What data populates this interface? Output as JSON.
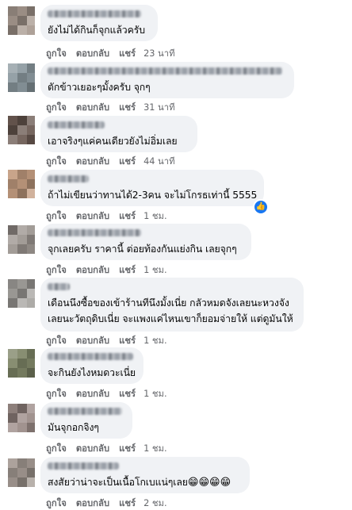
{
  "actions": {
    "like": "ถูกใจ",
    "reply": "ตอบกลับ",
    "share": "แชร์"
  },
  "comments": [
    {
      "text": [
        "ยังไม่ได้กินก็จุกแล้วครับ"
      ],
      "time": "23 นาที"
    },
    {
      "text": [
        "ตักข้าวเยอะๆมั้งครับ จุกๆ"
      ],
      "time": "31 นาที"
    },
    {
      "text": [
        "เอาจริงๆแค่คนเดียวยังไม่อิ่มเลย"
      ],
      "time": "44 นาที"
    },
    {
      "text": [
        "ถ้าไม่เขียนว่าทานได้2-3คน จะไม่โกรธเท่านี้ 5555"
      ],
      "time": "1 ชม.",
      "reaction_icon": "like-icon",
      "reaction_glyph": "👍"
    },
    {
      "text": [
        "จุกเลยครับ ราคานี้ ต่อยท้องกันแย่งกิน เลยจุกๆ"
      ],
      "time": "1 ชม."
    },
    {
      "text": [
        "เดือนนึงซื้อของเข้าร้านทีนึงมั้งเนี่ย กลัวหมดจังเลยนะหวงจัง",
        "เลยนะวัตถุดิบเนี่ย จะแพงแค่ไหนเขาก็ยอมจ่ายให้ แต่ดูมันให้"
      ],
      "time": "1 ชม."
    },
    {
      "text": [
        "จะกินยังไงหมดวะเนี่ย"
      ],
      "time": "1 ชม."
    },
    {
      "text": [
        "มันจุกอกจิงๆ"
      ],
      "time": "1 ชม."
    },
    {
      "text": [
        "สงสัยว่าน่าจะเป็นเนื้อโกเบแน่ๆเลย"
      ],
      "emoji": "😁😁😁😁",
      "time": "2 ชม."
    }
  ],
  "colors": {
    "bubble": "#f0f2f5",
    "meta": "#65676b",
    "like_blue": "#1877f2"
  }
}
